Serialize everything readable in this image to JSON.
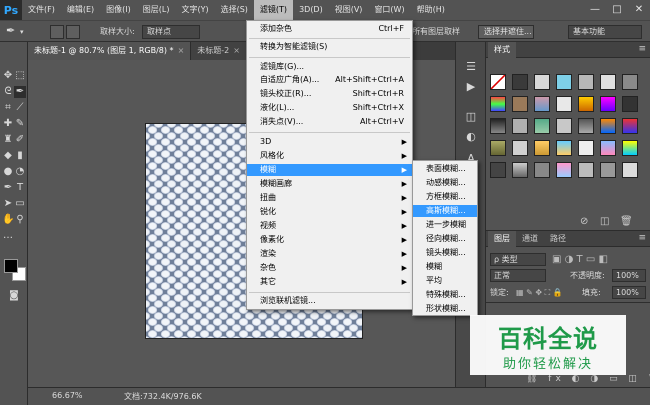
{
  "app": {
    "logo": "Ps"
  },
  "menubar": {
    "items": [
      "文件(F)",
      "编辑(E)",
      "图像(I)",
      "图层(L)",
      "文字(Y)",
      "选择(S)",
      "滤镜(T)",
      "3D(D)",
      "视图(V)",
      "窗口(W)",
      "帮助(H)"
    ],
    "active": "滤镜(T)",
    "window_controls": [
      "—",
      "□",
      "✕"
    ]
  },
  "optionsbar": {
    "sample_size_label": "取样大小:",
    "sample_size_value": "取样点",
    "all_layers_sample": "所有图层取样",
    "select_subject_button": "选择并遮住...",
    "workspace_value": "基本功能"
  },
  "tabs": [
    {
      "label": "未标题-1 @ 80.7% (图层 1, RGB/8) *",
      "close": "×"
    },
    {
      "label": "未标题-2",
      "close": "×"
    }
  ],
  "filter_menu": {
    "items": [
      {
        "label": "添加杂色",
        "shortcut": "Ctrl+F"
      },
      {
        "label": "转换为智能滤镜(S)"
      },
      {
        "label": "滤镜库(G)..."
      },
      {
        "label": "自适应广角(A)...",
        "shortcut": "Alt+Shift+Ctrl+A"
      },
      {
        "label": "镜头校正(R)...",
        "shortcut": "Shift+Ctrl+R"
      },
      {
        "label": "液化(L)...",
        "shortcut": "Shift+Ctrl+X"
      },
      {
        "label": "消失点(V)...",
        "shortcut": "Alt+Ctrl+V"
      },
      {
        "label": "3D",
        "submenu": true
      },
      {
        "label": "风格化",
        "submenu": true
      },
      {
        "label": "模糊",
        "submenu": true,
        "highlighted": true
      },
      {
        "label": "模糊画廊",
        "submenu": true
      },
      {
        "label": "扭曲",
        "submenu": true
      },
      {
        "label": "锐化",
        "submenu": true
      },
      {
        "label": "视频",
        "submenu": true
      },
      {
        "label": "像素化",
        "submenu": true
      },
      {
        "label": "渲染",
        "submenu": true
      },
      {
        "label": "杂色",
        "submenu": true
      },
      {
        "label": "其它",
        "submenu": true
      },
      {
        "label": "浏览联机滤镜..."
      }
    ]
  },
  "blur_submenu": {
    "items": [
      {
        "label": "表面模糊..."
      },
      {
        "label": "动感模糊..."
      },
      {
        "label": "方框模糊..."
      },
      {
        "label": "高斯模糊...",
        "highlighted": true
      },
      {
        "label": "进一步模糊"
      },
      {
        "label": "径向模糊..."
      },
      {
        "label": "镜头模糊..."
      },
      {
        "label": "模糊"
      },
      {
        "label": "平均"
      },
      {
        "label": "特殊模糊..."
      },
      {
        "label": "形状模糊..."
      }
    ]
  },
  "styles_panel": {
    "tab": "样式"
  },
  "layers_panel": {
    "tabs": [
      "图层",
      "通道",
      "路径"
    ],
    "kind_label": "ρ 类型",
    "blend_mode": "正常",
    "opacity_label": "不透明度:",
    "opacity_value": "100%",
    "lock_label": "锁定:",
    "fill_label": "填充:",
    "fill_value": "100%"
  },
  "statusbar": {
    "zoom": "66.67%",
    "doc_info": "文档:732.4K/976.6K"
  },
  "watermark": {
    "title": "百科全说",
    "subtitle": "助你轻松解决"
  },
  "colors": {
    "accent": "#3399ff",
    "watermark_green": "#1f9a49",
    "panel": "#535353"
  }
}
